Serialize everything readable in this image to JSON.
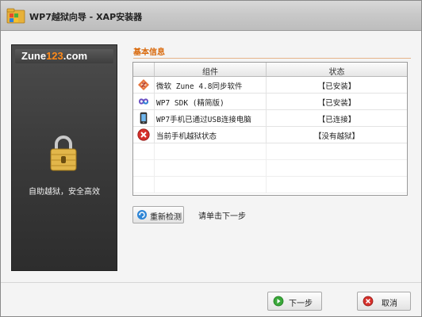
{
  "window": {
    "title": "WP7越狱向导 - XAP安装器"
  },
  "sidebar": {
    "logo": {
      "part1": "Zune",
      "part2": "123",
      "part3": ".com"
    },
    "slogan": "自助越狱，安全高效"
  },
  "section": {
    "title": "基本信息"
  },
  "table": {
    "columns": [
      "组件",
      "状态"
    ],
    "rows": [
      {
        "icon": "zune-icon",
        "name": "微软 Zune 4.8同步软件",
        "status": "【已安装】"
      },
      {
        "icon": "infinity-sdk-icon",
        "name": "WP7 SDK (精简版)",
        "status": "【已安装】"
      },
      {
        "icon": "phone-icon",
        "name": "WP7手机已通过USB连接电脑",
        "status": "【已连接】"
      },
      {
        "icon": "error-x-icon",
        "name": "当前手机越狱状态",
        "status": "【没有越狱】"
      }
    ]
  },
  "actions": {
    "recheck_label": "重新检测",
    "hint": "请单击下一步",
    "next_label": "下一步",
    "cancel_label": "取消"
  },
  "colors": {
    "section_title": "#d9690b",
    "sidebar_bg": "#3a3a3a",
    "logo_accent": "#ff8a1a",
    "error_red": "#d6302b"
  }
}
